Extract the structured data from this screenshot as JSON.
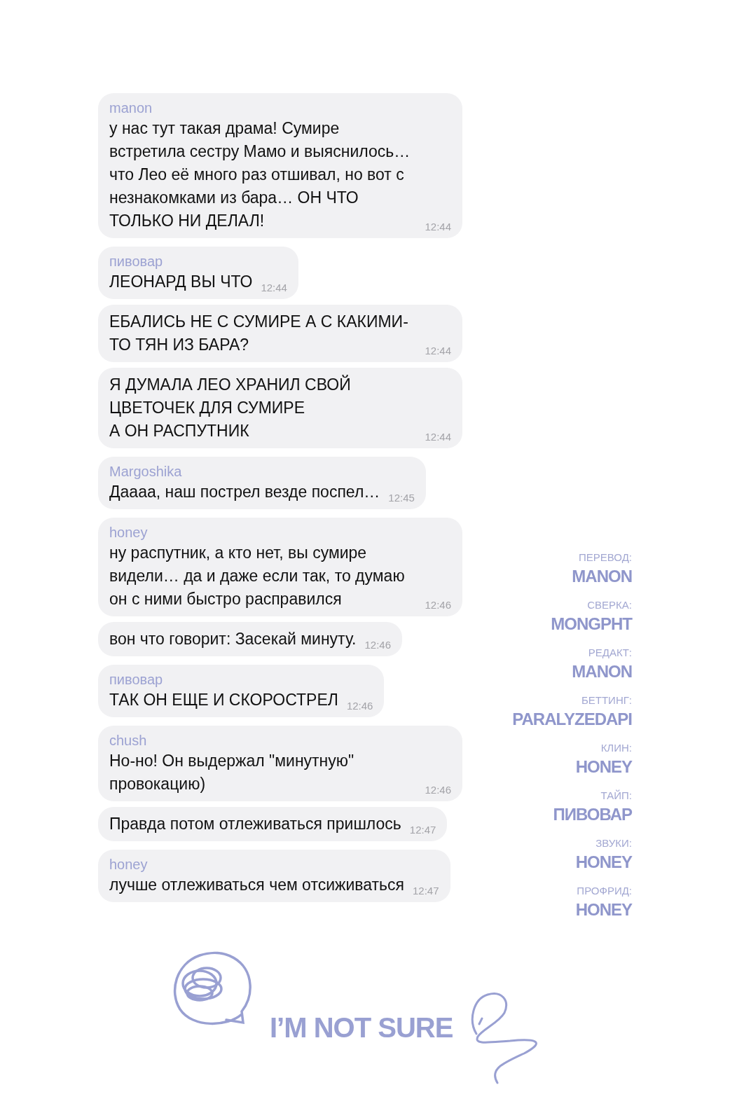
{
  "messages": [
    {
      "sender": "manon",
      "text": "у нас тут такая драма! Сумире встретила сестру Мамо и выяснилось… что Лео её много раз отшивал, но вот с незнакомками из бара… ОН ЧТО ТОЛЬКО НИ ДЕЛАЛ!",
      "time": "12:44"
    },
    {
      "sender": "пивовар",
      "text": "ЛЕОНАРД ВЫ ЧТО",
      "time": "12:44"
    },
    {
      "text": "ЕБАЛИСЬ НЕ С СУМИРЕ А С КАКИМИ-ТО ТЯН ИЗ БАРА?",
      "time": "12:44"
    },
    {
      "text": "Я ДУМАЛА ЛЕО ХРАНИЛ СВОЙ ЦВЕТОЧЕК ДЛЯ СУМИРЕ\nА ОН РАСПУТНИК",
      "time": "12:44"
    },
    {
      "sender": "Margoshika",
      "text": "Даааа, наш пострел везде поспел…",
      "time": "12:45"
    },
    {
      "sender": "honey",
      "text": "ну распутник, а кто нет, вы сумире видели… да и даже если так, то думаю он с ними быстро расправился",
      "time": "12:46"
    },
    {
      "text": "вон что говорит: Засекай минуту.",
      "time": "12:46"
    },
    {
      "sender": "пивовар",
      "text": "ТАК ОН ЕЩЕ И СКОРОСТРЕЛ",
      "time": "12:46"
    },
    {
      "sender": "chush",
      "text": "Но-но! Он выдержал \"минутную\" провокацию)",
      "time": "12:46"
    },
    {
      "text": "Правда потом отлеживаться пришлось",
      "time": "12:47"
    },
    {
      "sender": "honey",
      "text": "лучше отлеживаться чем отсиживаться",
      "time": "12:47"
    }
  ],
  "credits": [
    {
      "role": "ПЕРЕВОД:",
      "name": "MANON"
    },
    {
      "role": "СВЕРКА:",
      "name": "MONGPHT"
    },
    {
      "role": "РЕДАКТ:",
      "name": "MANON"
    },
    {
      "role": "БЕТТИНГ:",
      "name": "PARALYZEDAPI"
    },
    {
      "role": "КЛИН:",
      "name": "HONEY"
    },
    {
      "role": "ТАЙП:",
      "name": "ПИВОВАР"
    },
    {
      "role": "ЗВУКИ:",
      "name": "HONEY"
    },
    {
      "role": "ПРОФРИД:",
      "name": "HONEY"
    }
  ],
  "logo": {
    "text": "I’M NOT SURE"
  }
}
